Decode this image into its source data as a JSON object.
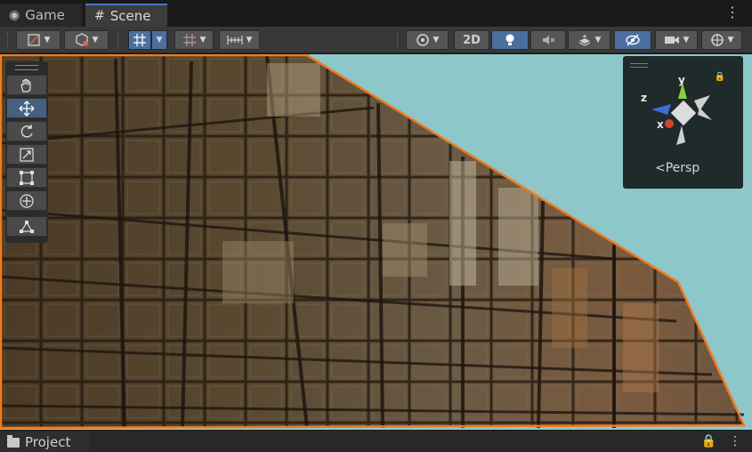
{
  "tabs": [
    {
      "label": "Game",
      "icon": "gamepad-icon",
      "active": false
    },
    {
      "label": "Scene",
      "icon": "hash-icon",
      "active": true
    }
  ],
  "toolbar": {
    "two_d_label": "2D",
    "buttons": [
      "draw-mode-icon",
      "render-mode-icon",
      "grid-snap-icon",
      "increment-snap-icon",
      "ruler-icon",
      "orbit-icon",
      "2d-toggle",
      "lighting-icon",
      "audio-mute-icon",
      "effects-icon",
      "visibility-icon",
      "camera-icon",
      "gizmos-icon"
    ]
  },
  "tools": [
    "hand-tool-icon",
    "move-tool-icon",
    "rotate-tool-icon",
    "scale-tool-icon",
    "rect-tool-icon",
    "transform-tool-icon",
    "custom-editor-tool-icon"
  ],
  "gizmo": {
    "x_label": "x",
    "y_label": "y",
    "z_label": "z",
    "projection_label": "<Persp"
  },
  "bottom": {
    "project_label": "Project"
  },
  "colors": {
    "sky": "#8ec7ca",
    "selection_outline": "#f07a1e",
    "accent_blue": "#4b6f9e",
    "y_axis": "#86d23a",
    "x_axis": "#d64330",
    "z_axis": "#3a6fd8"
  }
}
